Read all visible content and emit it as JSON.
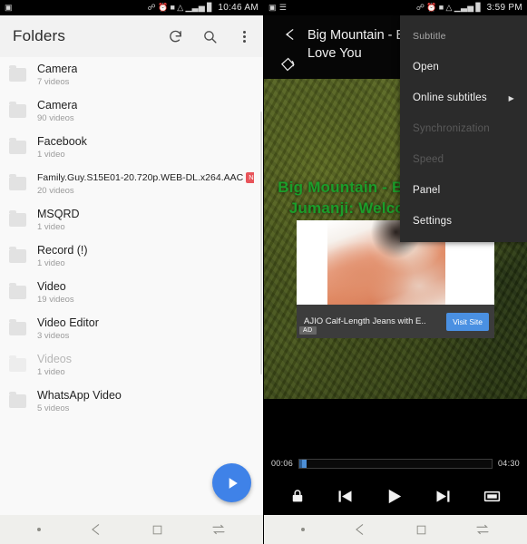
{
  "left_phone": {
    "statusbar": {
      "time": "10:46 AM",
      "left_icons": [
        "image-icon"
      ],
      "right_icons": [
        "bluetooth-icon",
        "alarm-icon",
        "vibrate-icon",
        "wifi-icon",
        "signal-icon",
        "battery-icon"
      ]
    },
    "toolbar": {
      "title": "Folders",
      "refresh_label": "refresh-icon",
      "search_label": "search-icon",
      "overflow_label": "more-options-icon"
    },
    "folders": [
      {
        "name": "Camera",
        "count": "7 videos",
        "dim": false,
        "badge": ""
      },
      {
        "name": "Camera",
        "count": "90 videos",
        "dim": false,
        "badge": ""
      },
      {
        "name": "Facebook",
        "count": "1 video",
        "dim": false,
        "badge": ""
      },
      {
        "name": "Family.Guy.S15E01-20.720p.WEB-DL.x264.AAC",
        "count": "20 videos",
        "dim": false,
        "badge": "NEW"
      },
      {
        "name": "MSQRD",
        "count": "1 video",
        "dim": false,
        "badge": ""
      },
      {
        "name": "Record (!)",
        "count": "1 video",
        "dim": false,
        "badge": ""
      },
      {
        "name": "Video",
        "count": "19 videos",
        "dim": false,
        "badge": ""
      },
      {
        "name": "Video Editor",
        "count": "3 videos",
        "dim": false,
        "badge": ""
      },
      {
        "name": "Videos",
        "count": "1 video",
        "dim": true,
        "badge": ""
      },
      {
        "name": "WhatsApp Video",
        "count": "5 videos",
        "dim": false,
        "badge": ""
      }
    ],
    "fab": {
      "label": "play-fab",
      "color": "#3f82e8"
    },
    "navbar": {
      "items": [
        "dot-icon",
        "back-icon",
        "home-icon",
        "recents-icon"
      ]
    }
  },
  "right_phone": {
    "statusbar": {
      "time": "3:59 PM",
      "left_icons": [
        "image-icon",
        "equalizer-icon"
      ],
      "right_icons": [
        "bluetooth-icon",
        "alarm-icon",
        "vibrate-icon",
        "wifi-icon",
        "signal-icon",
        "battery-icon"
      ]
    },
    "player": {
      "title": "Big Mountain - Baby I Love You",
      "back_label": "back-arrow-icon",
      "rotate_label": "screen-rotate-icon",
      "subtitle_line1": "Big Mountain - Baby I Love You",
      "subtitle_line2": "Jumanji: Welcome to Jungle",
      "subtitle_color": "#1b9e2a",
      "current_time": "00:06",
      "total_time": "04:30",
      "progress_percent": 2,
      "controls": [
        "lock-icon",
        "previous-icon",
        "play-icon",
        "next-icon",
        "aspect-ratio-icon"
      ]
    },
    "menu": {
      "items": [
        {
          "label": "Subtitle",
          "type": "header",
          "arrow": false
        },
        {
          "label": "Open",
          "type": "normal",
          "arrow": false
        },
        {
          "label": "Online subtitles",
          "type": "normal",
          "arrow": true
        },
        {
          "label": "Synchronization",
          "type": "disabled",
          "arrow": false
        },
        {
          "label": "Speed",
          "type": "disabled",
          "arrow": false
        },
        {
          "label": "Panel",
          "type": "normal",
          "arrow": false
        },
        {
          "label": "Settings",
          "type": "normal",
          "arrow": false
        }
      ],
      "background": "#2b2b2b"
    },
    "ad": {
      "tag": "AD",
      "text": "AJIO Calf-Length Jeans with E..",
      "button": "Visit Site",
      "button_color": "#4a90e2"
    },
    "navbar": {
      "items": [
        "dot-icon",
        "back-icon",
        "home-icon",
        "recents-icon"
      ]
    }
  }
}
